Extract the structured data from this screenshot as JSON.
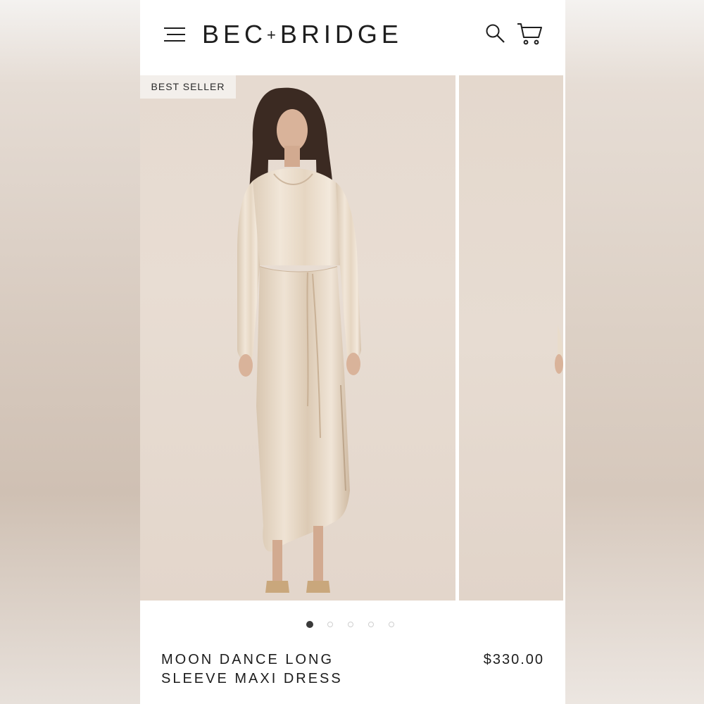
{
  "header": {
    "brand_left": "BEC",
    "brand_plus": "+",
    "brand_right": "BRIDGE",
    "menu_icon": "hamburger-menu-icon",
    "search_icon": "search-icon",
    "cart_icon": "shopping-cart-icon"
  },
  "gallery": {
    "badge": "BEST SELLER",
    "slide_count": 5,
    "active_slide": 1
  },
  "product": {
    "title": "MOON DANCE LONG\nSLEEVE MAXI DRESS",
    "price": "$330.00"
  },
  "colors": {
    "background": "#ffffff",
    "text": "#1c1c1c",
    "photo_backdrop": "#e6dad0",
    "dress": "#e8dac8",
    "active_dot": "#3a3a3a",
    "inactive_dot": "#cfcfcf"
  }
}
